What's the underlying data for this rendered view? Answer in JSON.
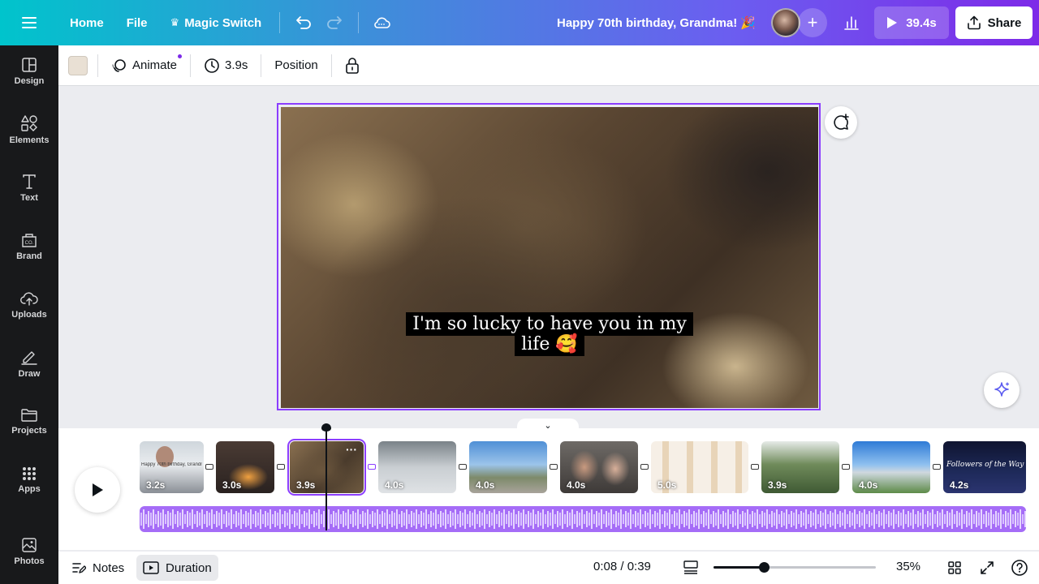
{
  "topbar": {
    "home": "Home",
    "file": "File",
    "magic_switch": "Magic Switch",
    "title": "Happy 70th birthday, Grandma! 🎉",
    "play_duration": "39.4s",
    "share": "Share"
  },
  "sidebar": {
    "items": [
      {
        "label": "Design",
        "icon": "design-icon"
      },
      {
        "label": "Elements",
        "icon": "elements-icon"
      },
      {
        "label": "Text",
        "icon": "text-icon"
      },
      {
        "label": "Brand",
        "icon": "brand-icon"
      },
      {
        "label": "Uploads",
        "icon": "uploads-icon"
      },
      {
        "label": "Draw",
        "icon": "draw-icon"
      },
      {
        "label": "Projects",
        "icon": "projects-icon"
      },
      {
        "label": "Apps",
        "icon": "apps-icon"
      },
      {
        "label": "Photos",
        "icon": "photos-icon"
      }
    ]
  },
  "context_toolbar": {
    "color": "#e9e0d4",
    "animate": "Animate",
    "duration": "3.9s",
    "position": "Position"
  },
  "canvas": {
    "caption_line1": "I'm so lucky to have you in my",
    "caption_line2": "life 🥰"
  },
  "timeline": {
    "clips": [
      {
        "duration": "3.2s",
        "caption": "Happy 70th birthday, Grandma"
      },
      {
        "duration": "3.0s",
        "caption": ""
      },
      {
        "duration": "3.9s",
        "caption": "",
        "selected": true
      },
      {
        "duration": "4.0s",
        "caption": ""
      },
      {
        "duration": "4.0s",
        "caption": ""
      },
      {
        "duration": "4.0s",
        "caption": ""
      },
      {
        "duration": "5.0s",
        "caption": ""
      },
      {
        "duration": "3.9s",
        "caption": ""
      },
      {
        "duration": "4.0s",
        "caption": ""
      },
      {
        "duration": "4.2s",
        "caption": "Followers of the Way"
      }
    ]
  },
  "bottombar": {
    "notes": "Notes",
    "duration": "Duration",
    "time": "0:08 / 0:39",
    "zoom_level": 0.31,
    "zoom": "35%"
  },
  "colors": {
    "accent": "#8b3dff",
    "sidebar_bg": "#18191b"
  }
}
